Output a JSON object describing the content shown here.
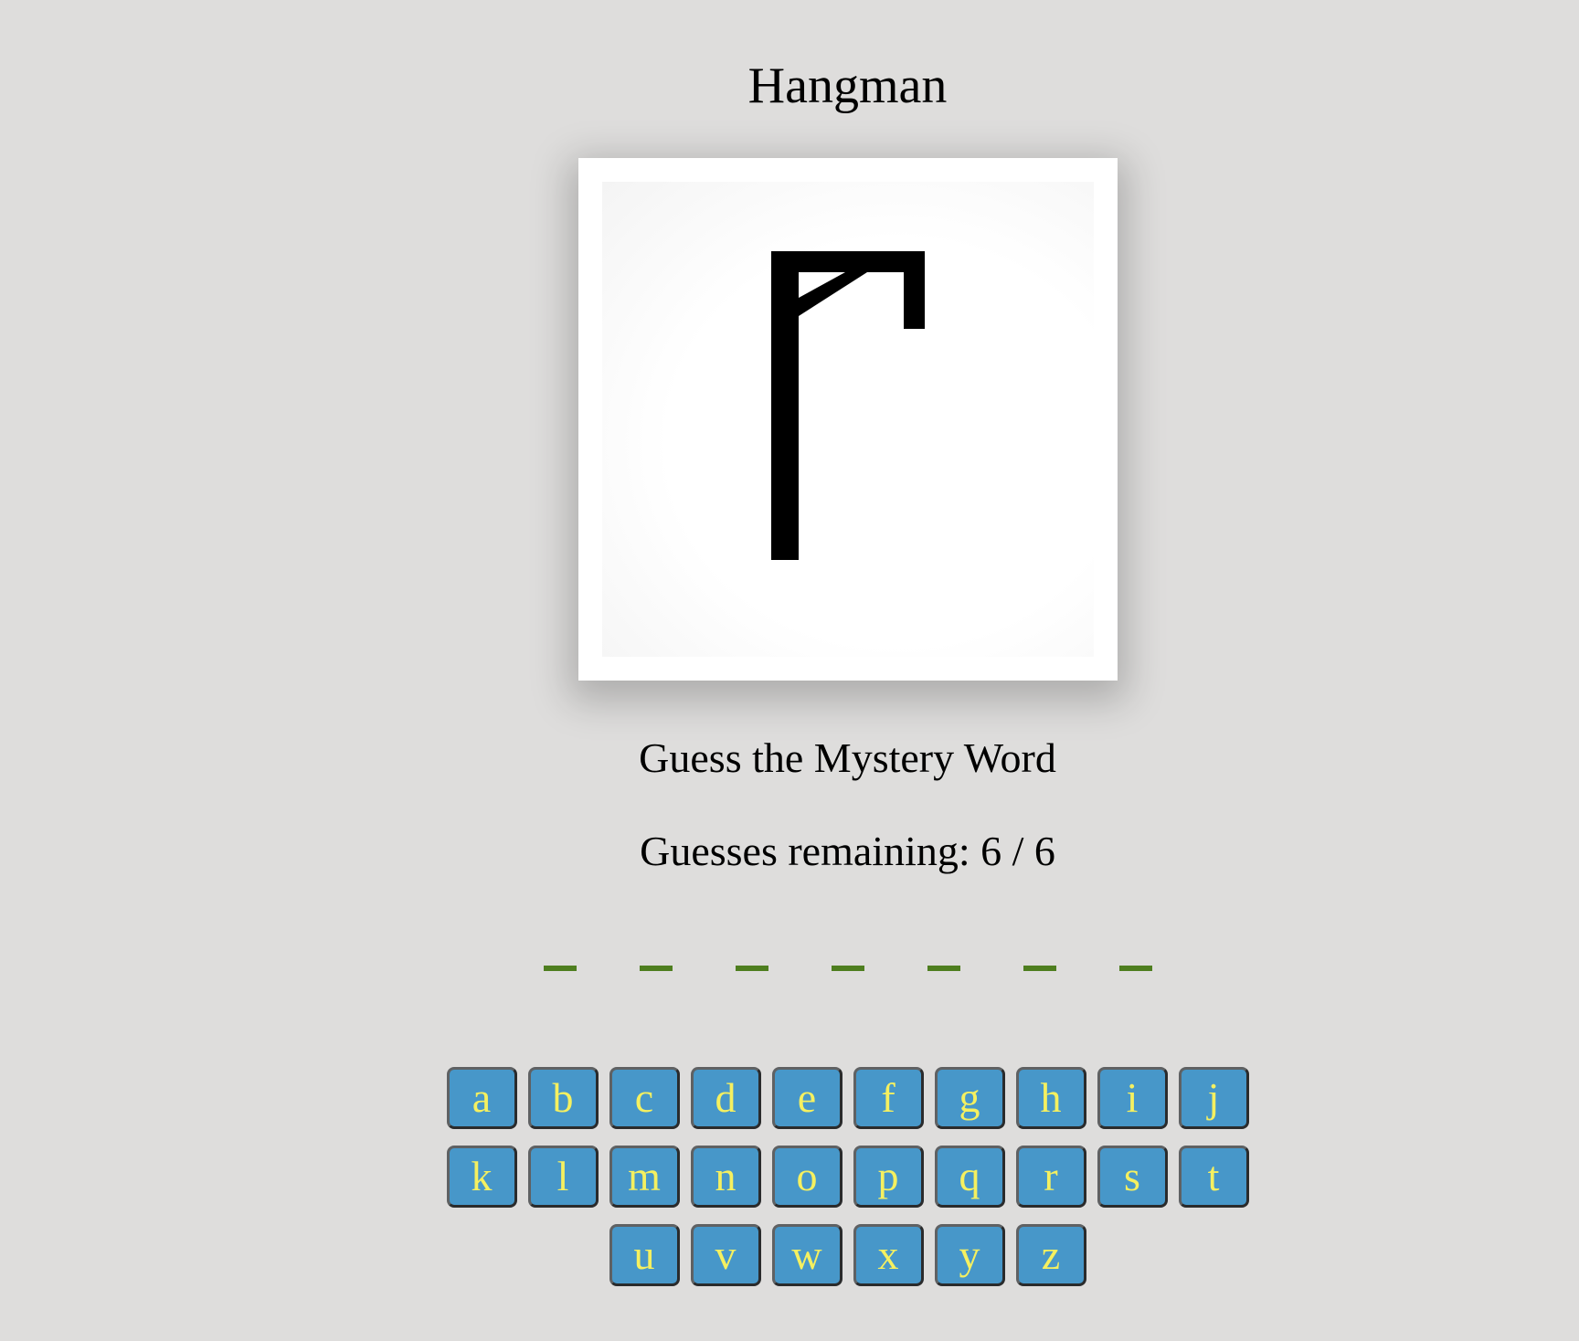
{
  "app": {
    "title": "Hangman",
    "subtitle": "Guess the Mystery Word",
    "guesses_text": "Guesses remaining: 6 / 6",
    "guesses_remaining": 6,
    "guesses_total": 6
  },
  "word": {
    "blank_count": 7,
    "blank_color": "#4e7e1f"
  },
  "colors": {
    "background": "#dedddc",
    "key_bg": "#4797c9",
    "key_text": "#f5f060",
    "gallows": "#000000"
  },
  "keyboard": {
    "rows": [
      [
        "a",
        "b",
        "c",
        "d",
        "e",
        "f",
        "g",
        "h",
        "i",
        "j"
      ],
      [
        "k",
        "l",
        "m",
        "n",
        "o",
        "p",
        "q",
        "r",
        "s",
        "t"
      ],
      [
        "u",
        "v",
        "w",
        "x",
        "y",
        "z"
      ]
    ]
  }
}
